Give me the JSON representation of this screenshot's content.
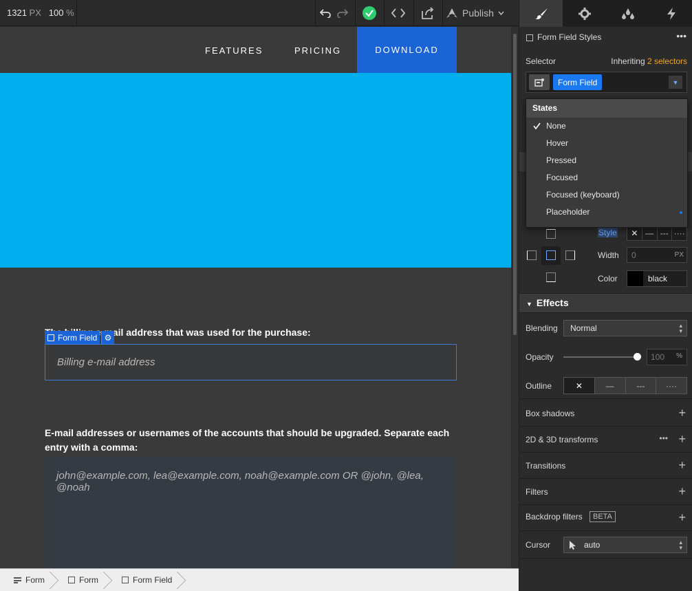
{
  "topbar": {
    "width_value": "1321",
    "width_unit": "PX",
    "zoom_value": "100",
    "zoom_unit": "%",
    "publish_label": "Publish"
  },
  "canvas": {
    "nav_links": [
      "FEATURES",
      "PRICING"
    ],
    "nav_download": "DOWNLOAD",
    "field1_label": "The billing e-mail address that was used for the purchase:",
    "field1_placeholder": "Billing e-mail address",
    "selected_tag": "Form Field",
    "field2_label": "E-mail addresses or usernames of the accounts that should be upgraded. Separate each entry with a comma:",
    "field2_placeholder": "john@example.com, lea@example.com, noah@example.com OR @john, @lea, @noah"
  },
  "breadcrumb": [
    "Form",
    "Form",
    "Form Field"
  ],
  "panel": {
    "title": "Form Field Styles",
    "selector_label": "Selector",
    "inheriting_prefix": "Inheriting",
    "inheriting_link": "2 selectors",
    "selector_chip": "Form Field",
    "states_header": "States",
    "states": [
      "None",
      "Hover",
      "Pressed",
      "Focused",
      "Focused (keyboard)",
      "Placeholder"
    ],
    "border": {
      "style_label": "Style",
      "width_label": "Width",
      "width_value": "0",
      "width_unit": "PX",
      "color_label": "Color",
      "color_value": "black"
    },
    "effects": {
      "header": "Effects",
      "blending_label": "Blending",
      "blending_value": "Normal",
      "opacity_label": "Opacity",
      "opacity_value": "100",
      "opacity_unit": "%",
      "opacity_fraction": 1.0,
      "outline_label": "Outline",
      "rows": [
        "Box shadows",
        "2D & 3D transforms",
        "Transitions",
        "Filters",
        "Backdrop filters"
      ],
      "beta_badge": "BETA",
      "cursor_label": "Cursor",
      "cursor_value": "auto"
    }
  },
  "colors": {
    "accent": "#1a78f0",
    "hero": "#00aeee",
    "inheriting_link": "#f5a623",
    "publish_ok": "#2ecc71"
  }
}
